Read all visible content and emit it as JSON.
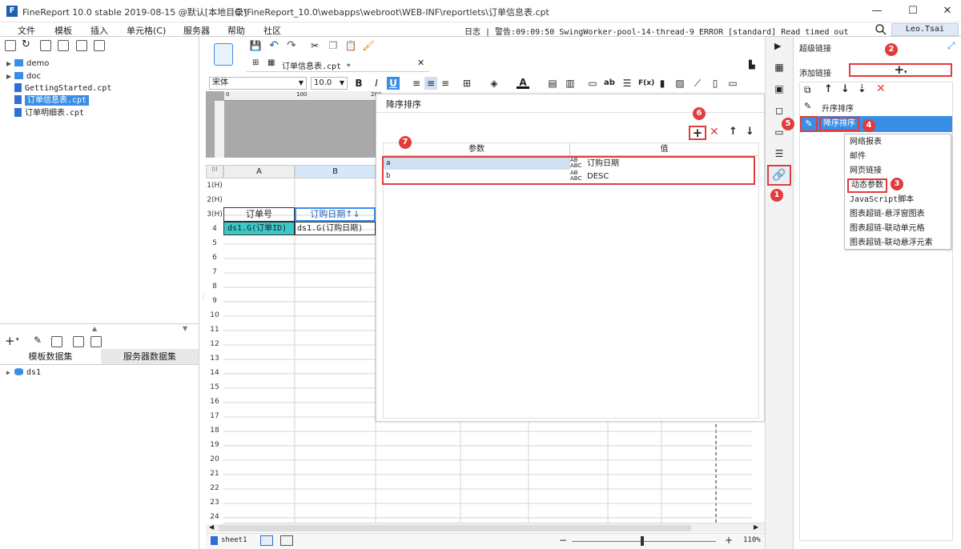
{
  "window": {
    "app_title": "FineReport 10.0 stable 2019-08-15 @默认[本地目录]",
    "file_path": "C:\\FineReport_10.0\\webapps\\webroot\\WEB-INF\\reportlets\\订单信息表.cpt",
    "minimize": "—",
    "maximize": "☐",
    "close": "✕"
  },
  "menu": {
    "items": [
      "文件",
      "模板",
      "插入",
      "单元格(C)",
      "服务器",
      "帮助",
      "社区"
    ],
    "log_text": "日志 | 警告:09:09:50 SwingWorker-pool-14-thread-9 ERROR [standard] Read timed out",
    "user": "Leo.Tsai"
  },
  "file_tree": {
    "items": [
      {
        "label": "demo",
        "type": "folder"
      },
      {
        "label": "doc",
        "type": "folder"
      },
      {
        "label": "GettingStarted.cpt",
        "type": "file"
      },
      {
        "label": "订单信息表.cpt",
        "type": "file",
        "selected": true
      },
      {
        "label": "订单明细表.cpt",
        "type": "file"
      }
    ]
  },
  "dataset_panel": {
    "tab_template": "模板数据集",
    "tab_server": "服务器数据集",
    "datasets": [
      "ds1"
    ]
  },
  "editor": {
    "tab_label": "订单信息表.cpt *",
    "font_name": "宋体",
    "font_size": "10.0",
    "bold": "B",
    "italic": "I",
    "underline": "U",
    "ruler_marks": [
      "0",
      "100",
      "200"
    ],
    "col_headers": [
      "A",
      "B"
    ],
    "row_headers": [
      "1(H)",
      "2(H)",
      "3(H)",
      "4",
      "5",
      "6",
      "7",
      "8",
      "9",
      "10",
      "11",
      "12",
      "13",
      "14",
      "15",
      "16",
      "17",
      "18",
      "19",
      "20",
      "21",
      "22",
      "23",
      "24"
    ],
    "cells": {
      "a3": "订单号",
      "b3": "订购日期↑↓",
      "a4": "ds1.G(订单ID)",
      "b4": "ds1.G(订购日期)"
    },
    "sheet_tab": "sheet1",
    "zoom": "110%",
    "zoom_minus": "−",
    "zoom_plus": "+"
  },
  "dialog": {
    "title": "降序排序",
    "add": "+",
    "delete": "✕",
    "up": "↑",
    "down": "↓",
    "col_param": "参数",
    "col_value": "值",
    "rows": [
      {
        "param": "a",
        "value": "订购日期"
      },
      {
        "param": "b",
        "value": "DESC"
      }
    ]
  },
  "right_pane": {
    "header": "超级链接",
    "add_link_label": "添加链接",
    "add_button": "+",
    "link_items": [
      "升序排序",
      "降序排序"
    ],
    "dropdown_items": [
      "网络报表",
      "邮件",
      "网页链接",
      "动态参数",
      "JavaScript脚本",
      "图表超链-悬浮窗图表",
      "图表超链-联动单元格",
      "图表超链-联动悬浮元素"
    ]
  },
  "badges": [
    "1",
    "2",
    "3",
    "4",
    "5",
    "6",
    "7"
  ],
  "colors": {
    "accent": "#3a8ee6",
    "highlight_red": "#e23b3b",
    "cell_teal": "#3cc8c8"
  }
}
